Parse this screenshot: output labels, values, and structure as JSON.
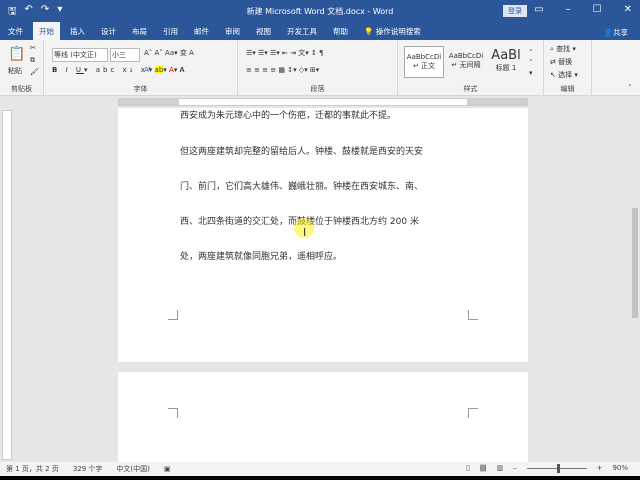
{
  "title": "新建 Microsoft Word 文档.docx  -  Word",
  "login": "登录",
  "tabs": [
    "文件",
    "开始",
    "插入",
    "设计",
    "布局",
    "引用",
    "邮件",
    "审阅",
    "视图",
    "开发工具",
    "帮助"
  ],
  "tell_me": "操作说明搜索",
  "share": "共享",
  "ribbon": {
    "paste": "粘贴",
    "clipboard": "剪贴板",
    "font_name": "等线 (中文正)",
    "font_size": "小三",
    "font": "字体",
    "paragraph": "段落",
    "styles": [
      {
        "sample": "AaBbCcDi",
        "name": "↵ 正文"
      },
      {
        "sample": "AaBbCcDi",
        "name": "↵ 无间隔"
      },
      {
        "sample": "AaBl",
        "name": "标题 1"
      }
    ],
    "styles_label": "样式",
    "find": "查找",
    "replace": "替换",
    "select": "选择",
    "editing": "编辑"
  },
  "document": {
    "lines": [
      "西安成为朱元璋心中的一个伤疤，迁都的事就此不提。",
      "但这两座建筑却完整的留给后人。钟楼、鼓楼就是西安的天安",
      "门、前门，它们高大雄伟、巍峨壮丽。钟楼在西安城东、南、",
      "西、北四条街道的交汇处，而鼓楼位于钟楼西北方约 200 米",
      "处，两座建筑就像同胞兄弟，遥相呼应。"
    ]
  },
  "status": {
    "page": "第 1 页，共 2 页",
    "words": "329 个字",
    "lang": "中文(中国)",
    "zoom": "90%"
  }
}
